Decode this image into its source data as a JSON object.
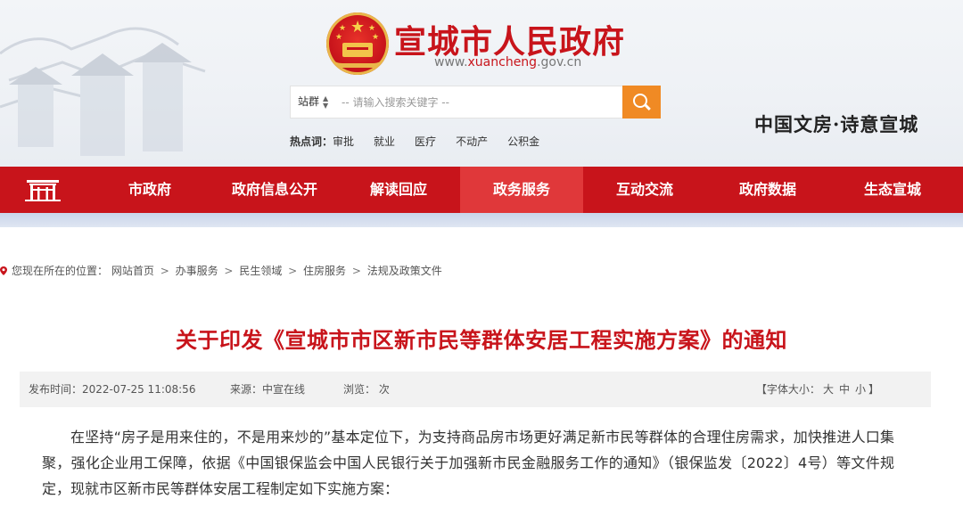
{
  "header": {
    "site_title": "宣城市人民政府",
    "site_url_prefix": "www.",
    "site_url_domain": "xuancheng",
    "site_url_suffix": ".gov.cn",
    "slogan": "中国文房·诗意宣城"
  },
  "search": {
    "scope": "站群",
    "placeholder": "-- 请输入搜索关键字 --",
    "button_icon": "search-icon"
  },
  "hot": {
    "label": "热点词：",
    "items": [
      "审批",
      "就业",
      "医疗",
      "不动产",
      "公积金"
    ]
  },
  "nav": {
    "home_icon": "home-gate-icon",
    "items": [
      "市政府",
      "政府信息公开",
      "解读回应",
      "政务服务",
      "互动交流",
      "政府数据",
      "生态宣城"
    ],
    "active_index": 3
  },
  "breadcrumb": {
    "prefix": "您现在所在的位置：",
    "items": [
      "网站首页",
      "办事服务",
      "民生领域",
      "住房服务",
      "法规及政策文件"
    ],
    "separator": ">"
  },
  "article": {
    "title": "关于印发《宣城市市区新市民等群体安居工程实施方案》的通知",
    "publish_time": "发布时间：2022-07-25 11:08:56",
    "source": "来源：中宣在线",
    "views": "浏览： 次",
    "font_size_label": "【字体大小：",
    "font_sizes": [
      "大",
      "中",
      "小"
    ],
    "font_size_close": "】",
    "paragraph": "在坚持“房子是用来住的，不是用来炒的”基本定位下，为支持商品房市场更好满足新市民等群体的合理住房需求，加快推进人口集聚，强化企业用工保障，依据《中国银保监会中国人民银行关于加强新市民金融服务工作的通知》（银保监发〔2022〕4号）等文件规定，现就市区新市民等群体安居工程制定如下实施方案："
  },
  "colors": {
    "brand_red": "#c8141b",
    "active_nav": "#e0383a",
    "search_button": "#f08a24"
  }
}
